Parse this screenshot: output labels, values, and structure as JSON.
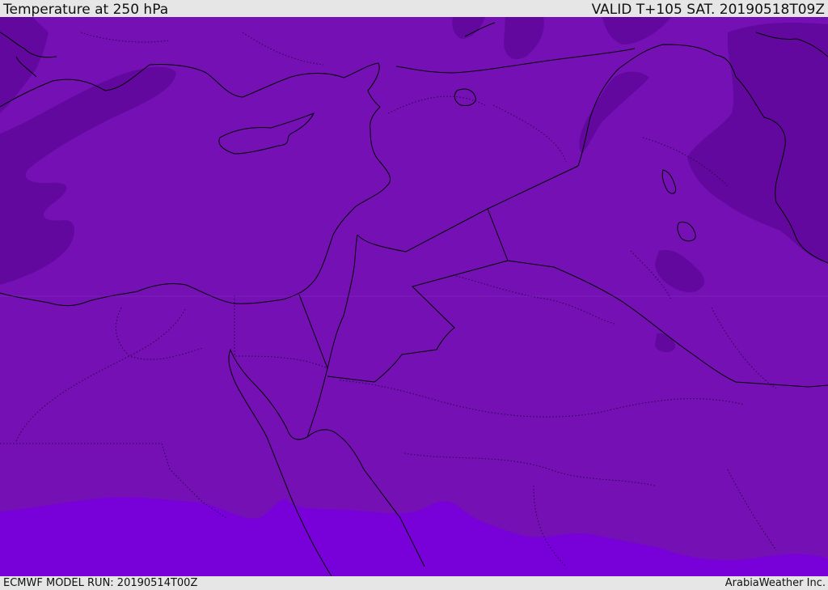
{
  "header": {
    "title": "Temperature at 250 hPa",
    "valid": "VALID T+105 SAT. 20190518T09Z"
  },
  "footer": {
    "model_run": "ECMWF MODEL RUN: 20190514T00Z",
    "credit": "ArabiaWeather Inc."
  },
  "colors": {
    "base_fill": "#7410b4",
    "cold_band": "#62089e",
    "warm_band": "#7800d8",
    "border_line": "#000000",
    "bar_background": "#e6e6e6"
  }
}
